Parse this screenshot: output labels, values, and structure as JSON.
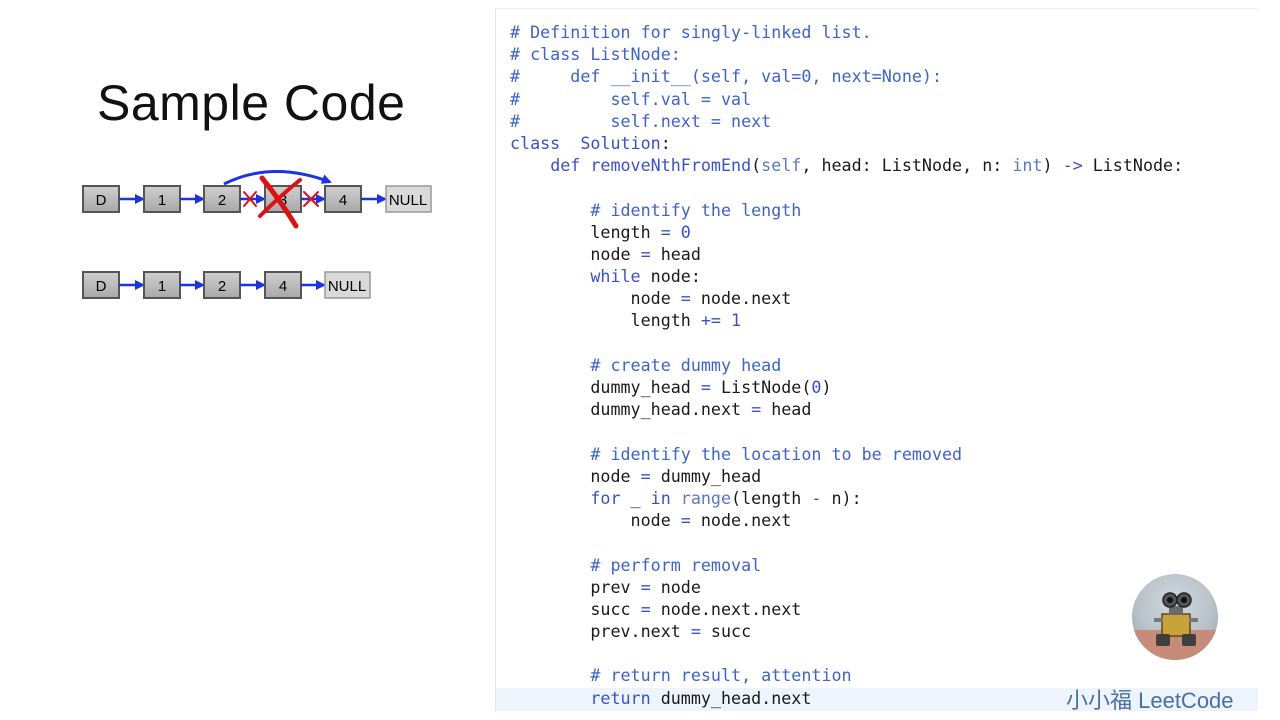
{
  "slide": {
    "title": "Sample Code",
    "brand": "小小福 LeetCode"
  },
  "diagram": {
    "before_nodes": [
      "D",
      "1",
      "2",
      "3",
      "4",
      "NULL"
    ],
    "after_nodes": [
      "D",
      "1",
      "2",
      "4",
      "NULL"
    ],
    "removed_node": "3"
  },
  "code_lines": [
    [
      [
        "cm",
        "# Definition for singly-linked list."
      ]
    ],
    [
      [
        "cm",
        "# class ListNode:"
      ]
    ],
    [
      [
        "cm",
        "#     def __init__(self, val=0, next=None):"
      ]
    ],
    [
      [
        "cm",
        "#         self.val = val"
      ]
    ],
    [
      [
        "cm",
        "#         self.next = next"
      ]
    ],
    [
      [
        "kw",
        "class"
      ],
      [
        "",
        "  "
      ],
      [
        "kw",
        "Solution"
      ],
      [
        "",
        ":"
      ]
    ],
    [
      [
        "",
        "    "
      ],
      [
        "kw",
        "def"
      ],
      [
        "",
        " "
      ],
      [
        "kw",
        "removeNthFromEnd"
      ],
      [
        "",
        "("
      ],
      [
        "bi",
        "self"
      ],
      [
        "",
        ", head: ListNode, n: "
      ],
      [
        "bi",
        "int"
      ],
      [
        "",
        ") "
      ],
      [
        "op",
        "->"
      ],
      [
        "",
        " ListNode:"
      ]
    ],
    [
      [
        "",
        ""
      ]
    ],
    [
      [
        "",
        "        "
      ],
      [
        "cm",
        "# identify the length"
      ]
    ],
    [
      [
        "",
        "        length "
      ],
      [
        "op",
        "="
      ],
      [
        "",
        " "
      ],
      [
        "nm",
        "0"
      ]
    ],
    [
      [
        "",
        "        node "
      ],
      [
        "op",
        "="
      ],
      [
        "",
        " head"
      ]
    ],
    [
      [
        "",
        "        "
      ],
      [
        "kw",
        "while"
      ],
      [
        "",
        " node:"
      ]
    ],
    [
      [
        "",
        "            node "
      ],
      [
        "op",
        "="
      ],
      [
        "",
        " node.next"
      ]
    ],
    [
      [
        "",
        "            length "
      ],
      [
        "op",
        "+="
      ],
      [
        "",
        " "
      ],
      [
        "nm",
        "1"
      ]
    ],
    [
      [
        "",
        ""
      ]
    ],
    [
      [
        "",
        "        "
      ],
      [
        "cm",
        "# create dummy head"
      ]
    ],
    [
      [
        "",
        "        dummy_head "
      ],
      [
        "op",
        "="
      ],
      [
        "",
        " ListNode("
      ],
      [
        "nm",
        "0"
      ],
      [
        "",
        ")"
      ]
    ],
    [
      [
        "",
        "        dummy_head.next "
      ],
      [
        "op",
        "="
      ],
      [
        "",
        " head"
      ]
    ],
    [
      [
        "",
        ""
      ]
    ],
    [
      [
        "",
        "        "
      ],
      [
        "cm",
        "# identify the location to be removed"
      ]
    ],
    [
      [
        "",
        "        node "
      ],
      [
        "op",
        "="
      ],
      [
        "",
        " dummy_head"
      ]
    ],
    [
      [
        "",
        "        "
      ],
      [
        "kw",
        "for"
      ],
      [
        "",
        " _ "
      ],
      [
        "kw",
        "in"
      ],
      [
        "",
        " "
      ],
      [
        "bi",
        "range"
      ],
      [
        "",
        "(length "
      ],
      [
        "op",
        "-"
      ],
      [
        "",
        " n):"
      ]
    ],
    [
      [
        "",
        "            node "
      ],
      [
        "op",
        "="
      ],
      [
        "",
        " node.next"
      ]
    ],
    [
      [
        "",
        ""
      ]
    ],
    [
      [
        "",
        "        "
      ],
      [
        "cm",
        "# perform removal"
      ]
    ],
    [
      [
        "",
        "        prev "
      ],
      [
        "op",
        "="
      ],
      [
        "",
        " node"
      ]
    ],
    [
      [
        "",
        "        succ "
      ],
      [
        "op",
        "="
      ],
      [
        "",
        " node.next.next"
      ]
    ],
    [
      [
        "",
        "        prev.next "
      ],
      [
        "op",
        "="
      ],
      [
        "",
        " succ"
      ]
    ],
    [
      [
        "",
        ""
      ]
    ],
    [
      [
        "",
        "        "
      ],
      [
        "cm",
        "# return result, attention"
      ]
    ],
    [
      [
        "",
        "        "
      ],
      [
        "kw",
        "return"
      ],
      [
        "",
        " dummy_head.next"
      ]
    ]
  ]
}
